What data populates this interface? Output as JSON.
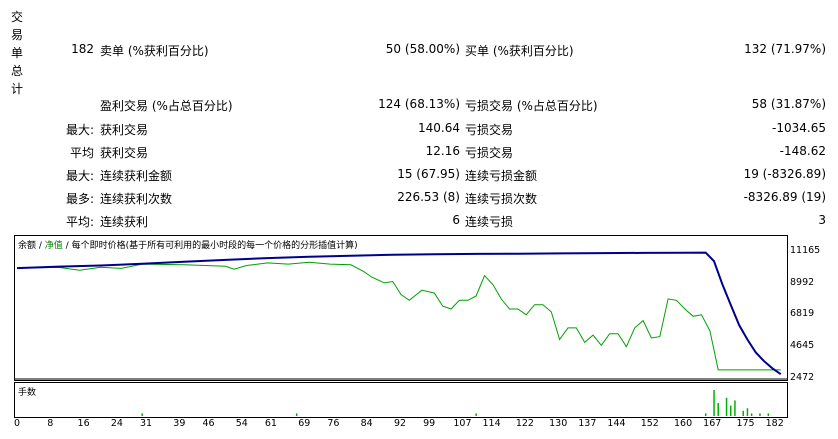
{
  "summary": {
    "vertical_label": [
      "交",
      "易",
      "单",
      "总",
      "计"
    ],
    "total_trades": "182",
    "short_label": "卖单 (%获利百分比)",
    "short_value": "50 (58.00%)",
    "long_label": "买单 (%获利百分比)",
    "long_value": "132 (71.97%)",
    "profit_trades_label": "盈利交易 (%占总百分比)",
    "profit_trades_value": "124 (68.13%)",
    "loss_trades_label": "亏损交易 (%占总百分比)",
    "loss_trades_value": "58 (31.87%)",
    "rows": [
      {
        "prefix": "最大:",
        "left_label": "获利交易",
        "left_value": "140.64",
        "right_label": "亏损交易",
        "right_value": "-1034.65"
      },
      {
        "prefix": "平均",
        "left_label": "获利交易",
        "left_value": "12.16",
        "right_label": "亏损交易",
        "right_value": "-148.62"
      },
      {
        "prefix": "最大:",
        "left_label": "连续获利金额",
        "left_value": "15 (67.95)",
        "right_label": "连续亏损金额",
        "right_value": "19 (-8326.89)"
      },
      {
        "prefix": "最多:",
        "left_label": "连续获利次数",
        "left_value": "226.53 (8)",
        "right_label": "连续亏损次数",
        "right_value": "-8326.89 (19)"
      },
      {
        "prefix": "平均:",
        "left_label": "连续获利",
        "left_value": "6",
        "right_label": "连续亏损",
        "right_value": "3"
      }
    ]
  },
  "chart": {
    "legend_balance": "余额",
    "legend_sep1": " / ",
    "legend_equity": "净值",
    "legend_sep2": " / ",
    "legend_note": "每个即时价格(基于所有可利用的最小时段的每一个价格的分形插值计算)",
    "volume_label": "手数",
    "balance_color": "#00008b",
    "equity_color": "#00a000",
    "volume_color": "#00b000"
  },
  "chart_data": {
    "type": "line",
    "y_ticks": [
      "11165",
      "8992",
      "6819",
      "4645",
      "2472"
    ],
    "x_ticks": [
      "0",
      "8",
      "16",
      "24",
      "31",
      "39",
      "46",
      "54",
      "61",
      "69",
      "76",
      "84",
      "92",
      "99",
      "107",
      "114",
      "122",
      "130",
      "137",
      "144",
      "152",
      "160",
      "167",
      "175",
      "182"
    ],
    "ylim": [
      2472,
      11165
    ],
    "xlim": [
      0,
      184
    ],
    "series": [
      {
        "name": "余额",
        "x": [
          0,
          10,
          20,
          30,
          40,
          50,
          60,
          70,
          80,
          90,
          100,
          110,
          120,
          130,
          140,
          150,
          160,
          165,
          167,
          169,
          171,
          173,
          175,
          177,
          179,
          181,
          183
        ],
        "values": [
          10120,
          10230,
          10300,
          10420,
          10560,
          10690,
          10810,
          10900,
          10980,
          11040,
          11080,
          11100,
          11120,
          11140,
          11160,
          11175,
          11185,
          11190,
          10600,
          9000,
          7600,
          6200,
          5200,
          4300,
          3700,
          3200,
          2800
        ]
      },
      {
        "name": "净值",
        "x": [
          0,
          10,
          15,
          20,
          25,
          30,
          40,
          50,
          52,
          55,
          60,
          65,
          70,
          75,
          80,
          83,
          85,
          88,
          90,
          92,
          94,
          97,
          100,
          102,
          104,
          106,
          108,
          110,
          112,
          114,
          116,
          118,
          120,
          122,
          124,
          126,
          128,
          130,
          132,
          134,
          136,
          138,
          140,
          142,
          144,
          146,
          148,
          150,
          152,
          154,
          156,
          158,
          160,
          162,
          164,
          166,
          168,
          175,
          183
        ],
        "values": [
          10120,
          10170,
          9980,
          10180,
          10100,
          10400,
          10350,
          10250,
          10050,
          10300,
          10480,
          10400,
          10520,
          10400,
          10350,
          9900,
          9500,
          9100,
          9200,
          8300,
          7900,
          8600,
          8400,
          7500,
          7300,
          7900,
          7900,
          8200,
          9600,
          9000,
          8000,
          7300,
          7300,
          6900,
          7600,
          7600,
          7100,
          5200,
          6000,
          6000,
          5000,
          5500,
          4800,
          5600,
          5600,
          4700,
          6000,
          6500,
          5300,
          5400,
          8000,
          7900,
          7300,
          6800,
          6900,
          5800,
          3100,
          3100,
          3100
        ]
      }
    ],
    "volume": {
      "x": [
        30,
        67,
        110,
        165,
        167,
        168,
        170,
        171,
        172,
        174,
        175,
        176,
        178,
        180
      ],
      "values": [
        1,
        1,
        1,
        1,
        10,
        5,
        7,
        4,
        6,
        2,
        3,
        1,
        1,
        1
      ]
    }
  }
}
